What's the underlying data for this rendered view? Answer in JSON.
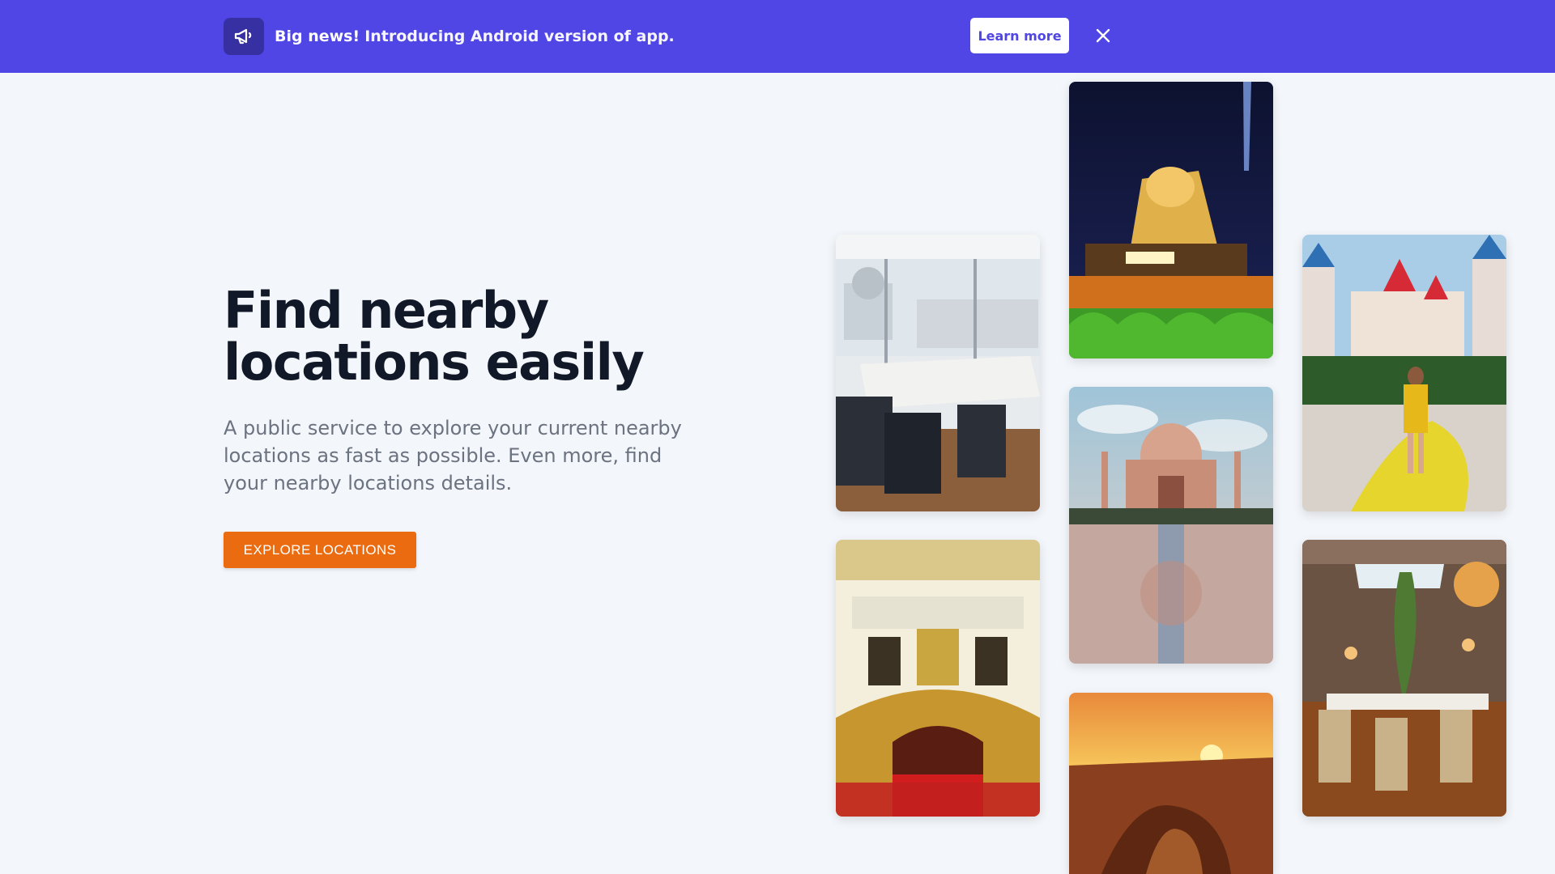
{
  "banner": {
    "headline": "Big news!",
    "message": "Introducing Android version of app.",
    "learn_more_label": "Learn more",
    "icon": "megaphone-icon",
    "close_icon": "close-icon",
    "background_color": "#4f46e5"
  },
  "hero": {
    "title_line1": "Find nearby",
    "title_line2": "locations easily",
    "description": "A public service to explore your current nearby locations as fast as possible. Even more, find your nearby locations details.",
    "cta_label": "EXPLORE LOCATIONS",
    "cta_color": "#ea6b10"
  },
  "gallery": {
    "images": [
      "restaurant-window-photo",
      "luxor-sphinx-night-photo",
      "castle-hotel-woman-photo",
      "palace-interior-photo",
      "taj-mahal-photo",
      "canyon-sunset-photo",
      "dining-room-photo"
    ]
  }
}
